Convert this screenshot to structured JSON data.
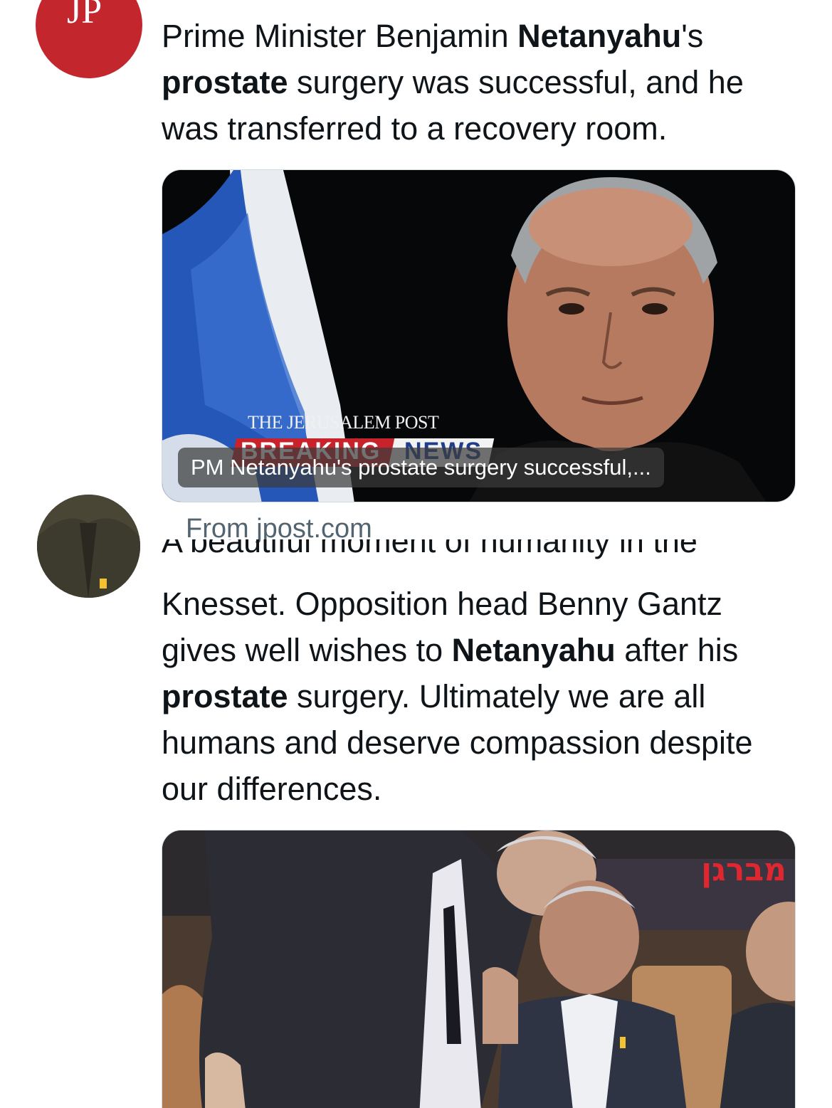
{
  "post1": {
    "text_prefix": "Prime Minister Benjamin ",
    "text_bold_1": "Netanyahu",
    "text_mid_1": "'s ",
    "text_bold_2": "prostate",
    "text_suffix": " surgery was successful, and he was transferred to a recovery room.",
    "media": {
      "wordmark": "THE JERUSALEM POST",
      "banner_breaking": "BREAKING",
      "banner_news": "NEWS",
      "caption": "PM Netanyahu's prostate surgery successful,..."
    },
    "source": "From jpost.com"
  },
  "post2": {
    "cutoff_line": "A beautiful moment of humanity in the",
    "text_prefix": "Knesset. Opposition head Benny Gantz gives well wishes to ",
    "text_bold_1": "Netanyahu",
    "text_mid_1": " after his ",
    "text_bold_2": "prostate",
    "text_suffix": " surgery. Ultimately we are all humans and deserve compassion despite our differences.",
    "media": {
      "tv_logo": "מברגן"
    }
  },
  "colors": {
    "jp_red": "#c3262d",
    "text": "#0f1419",
    "muted": "#536471"
  }
}
